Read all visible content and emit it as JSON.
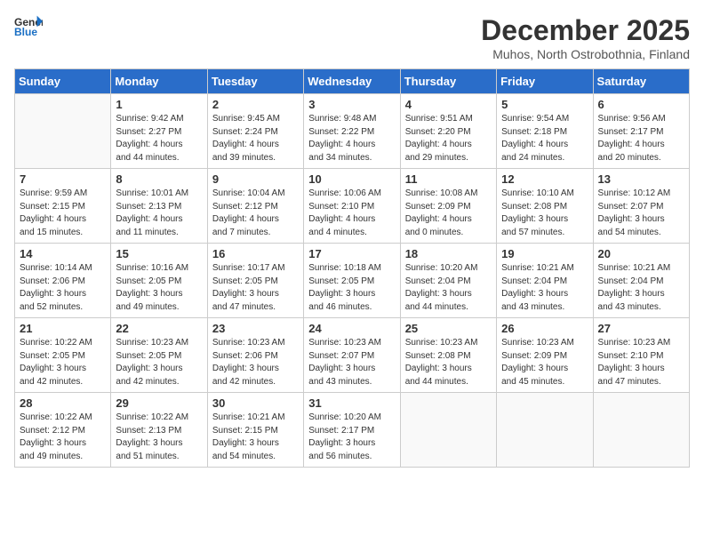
{
  "logo": {
    "line1": "General",
    "line2": "Blue"
  },
  "title": "December 2025",
  "location": "Muhos, North Ostrobothnia, Finland",
  "days_of_week": [
    "Sunday",
    "Monday",
    "Tuesday",
    "Wednesday",
    "Thursday",
    "Friday",
    "Saturday"
  ],
  "weeks": [
    [
      {
        "day": "",
        "info": ""
      },
      {
        "day": "1",
        "info": "Sunrise: 9:42 AM\nSunset: 2:27 PM\nDaylight: 4 hours\nand 44 minutes."
      },
      {
        "day": "2",
        "info": "Sunrise: 9:45 AM\nSunset: 2:24 PM\nDaylight: 4 hours\nand 39 minutes."
      },
      {
        "day": "3",
        "info": "Sunrise: 9:48 AM\nSunset: 2:22 PM\nDaylight: 4 hours\nand 34 minutes."
      },
      {
        "day": "4",
        "info": "Sunrise: 9:51 AM\nSunset: 2:20 PM\nDaylight: 4 hours\nand 29 minutes."
      },
      {
        "day": "5",
        "info": "Sunrise: 9:54 AM\nSunset: 2:18 PM\nDaylight: 4 hours\nand 24 minutes."
      },
      {
        "day": "6",
        "info": "Sunrise: 9:56 AM\nSunset: 2:17 PM\nDaylight: 4 hours\nand 20 minutes."
      }
    ],
    [
      {
        "day": "7",
        "info": "Sunrise: 9:59 AM\nSunset: 2:15 PM\nDaylight: 4 hours\nand 15 minutes."
      },
      {
        "day": "8",
        "info": "Sunrise: 10:01 AM\nSunset: 2:13 PM\nDaylight: 4 hours\nand 11 minutes."
      },
      {
        "day": "9",
        "info": "Sunrise: 10:04 AM\nSunset: 2:12 PM\nDaylight: 4 hours\nand 7 minutes."
      },
      {
        "day": "10",
        "info": "Sunrise: 10:06 AM\nSunset: 2:10 PM\nDaylight: 4 hours\nand 4 minutes."
      },
      {
        "day": "11",
        "info": "Sunrise: 10:08 AM\nSunset: 2:09 PM\nDaylight: 4 hours\nand 0 minutes."
      },
      {
        "day": "12",
        "info": "Sunrise: 10:10 AM\nSunset: 2:08 PM\nDaylight: 3 hours\nand 57 minutes."
      },
      {
        "day": "13",
        "info": "Sunrise: 10:12 AM\nSunset: 2:07 PM\nDaylight: 3 hours\nand 54 minutes."
      }
    ],
    [
      {
        "day": "14",
        "info": "Sunrise: 10:14 AM\nSunset: 2:06 PM\nDaylight: 3 hours\nand 52 minutes."
      },
      {
        "day": "15",
        "info": "Sunrise: 10:16 AM\nSunset: 2:05 PM\nDaylight: 3 hours\nand 49 minutes."
      },
      {
        "day": "16",
        "info": "Sunrise: 10:17 AM\nSunset: 2:05 PM\nDaylight: 3 hours\nand 47 minutes."
      },
      {
        "day": "17",
        "info": "Sunrise: 10:18 AM\nSunset: 2:05 PM\nDaylight: 3 hours\nand 46 minutes."
      },
      {
        "day": "18",
        "info": "Sunrise: 10:20 AM\nSunset: 2:04 PM\nDaylight: 3 hours\nand 44 minutes."
      },
      {
        "day": "19",
        "info": "Sunrise: 10:21 AM\nSunset: 2:04 PM\nDaylight: 3 hours\nand 43 minutes."
      },
      {
        "day": "20",
        "info": "Sunrise: 10:21 AM\nSunset: 2:04 PM\nDaylight: 3 hours\nand 43 minutes."
      }
    ],
    [
      {
        "day": "21",
        "info": "Sunrise: 10:22 AM\nSunset: 2:05 PM\nDaylight: 3 hours\nand 42 minutes."
      },
      {
        "day": "22",
        "info": "Sunrise: 10:23 AM\nSunset: 2:05 PM\nDaylight: 3 hours\nand 42 minutes."
      },
      {
        "day": "23",
        "info": "Sunrise: 10:23 AM\nSunset: 2:06 PM\nDaylight: 3 hours\nand 42 minutes."
      },
      {
        "day": "24",
        "info": "Sunrise: 10:23 AM\nSunset: 2:07 PM\nDaylight: 3 hours\nand 43 minutes."
      },
      {
        "day": "25",
        "info": "Sunrise: 10:23 AM\nSunset: 2:08 PM\nDaylight: 3 hours\nand 44 minutes."
      },
      {
        "day": "26",
        "info": "Sunrise: 10:23 AM\nSunset: 2:09 PM\nDaylight: 3 hours\nand 45 minutes."
      },
      {
        "day": "27",
        "info": "Sunrise: 10:23 AM\nSunset: 2:10 PM\nDaylight: 3 hours\nand 47 minutes."
      }
    ],
    [
      {
        "day": "28",
        "info": "Sunrise: 10:22 AM\nSunset: 2:12 PM\nDaylight: 3 hours\nand 49 minutes."
      },
      {
        "day": "29",
        "info": "Sunrise: 10:22 AM\nSunset: 2:13 PM\nDaylight: 3 hours\nand 51 minutes."
      },
      {
        "day": "30",
        "info": "Sunrise: 10:21 AM\nSunset: 2:15 PM\nDaylight: 3 hours\nand 54 minutes."
      },
      {
        "day": "31",
        "info": "Sunrise: 10:20 AM\nSunset: 2:17 PM\nDaylight: 3 hours\nand 56 minutes."
      },
      {
        "day": "",
        "info": ""
      },
      {
        "day": "",
        "info": ""
      },
      {
        "day": "",
        "info": ""
      }
    ]
  ]
}
